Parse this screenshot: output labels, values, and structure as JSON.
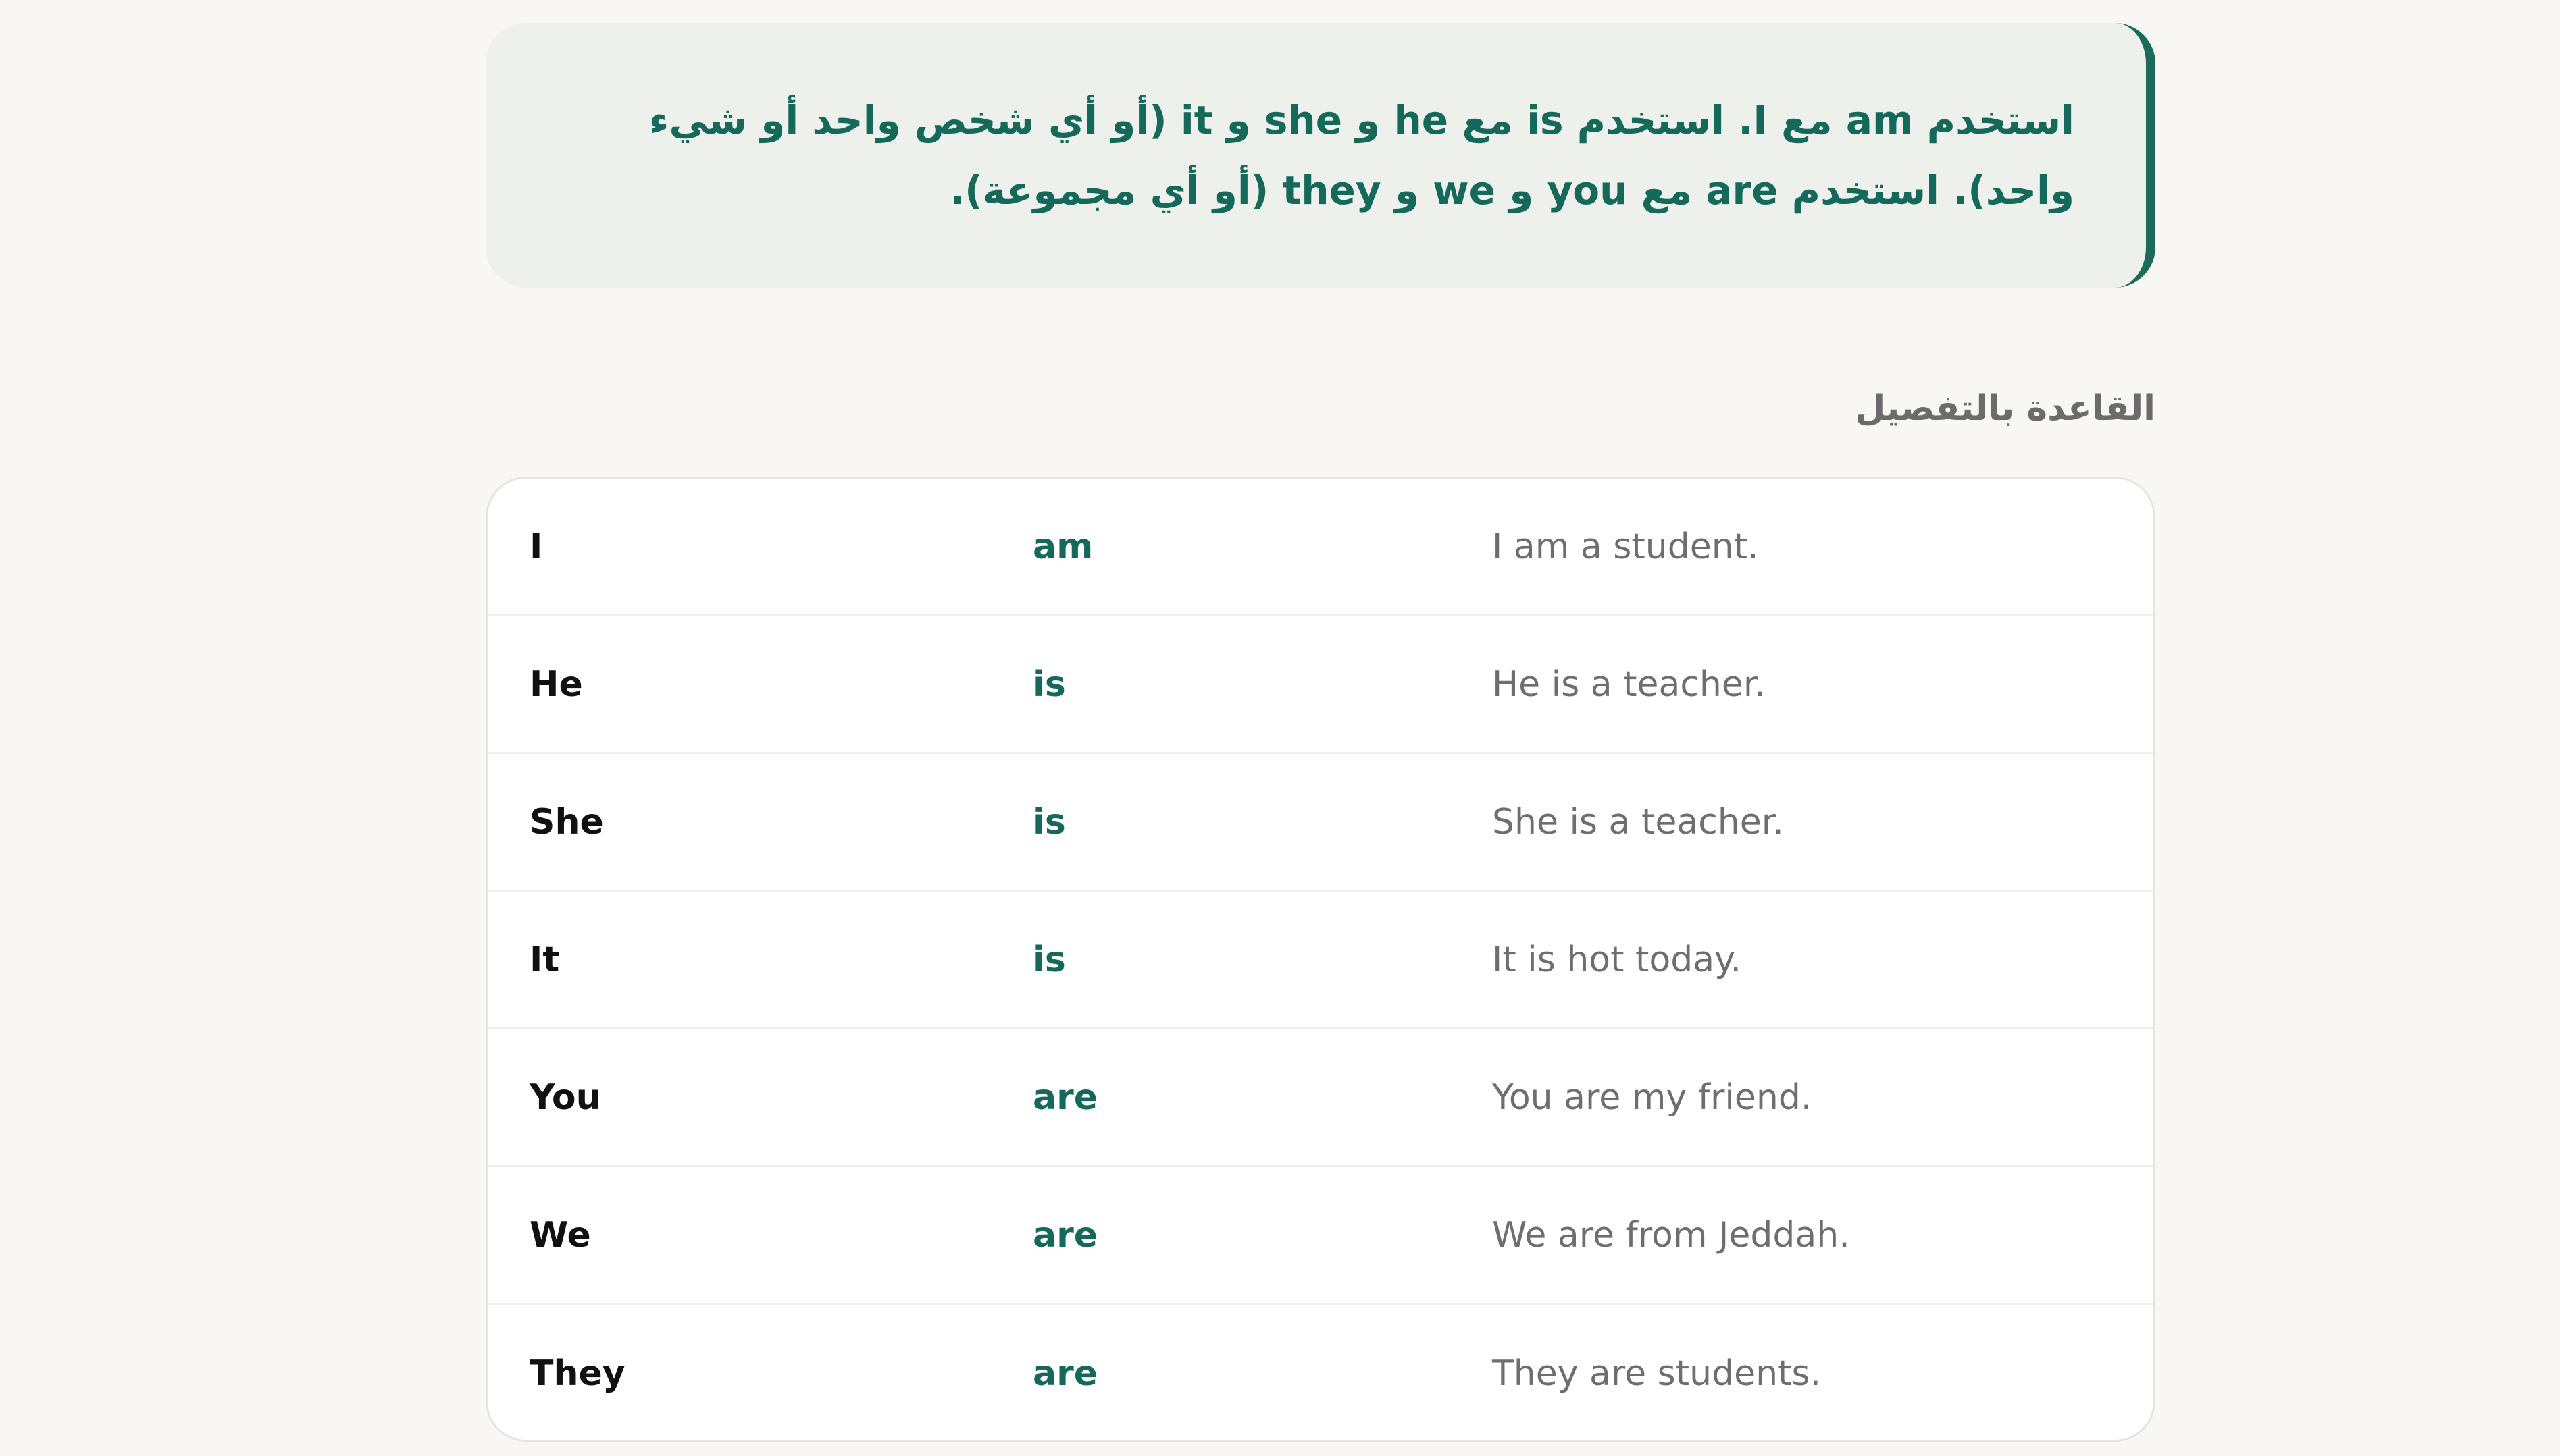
{
  "rule_callout": {
    "text": "استخدم am مع I. استخدم is مع he و she و it (أو أي شخص واحد أو شيء واحد). استخدم are مع you و we و they (أو أي مجموعة)."
  },
  "section": {
    "heading": "القاعدة بالتفصيل"
  },
  "table": {
    "rows": [
      {
        "subject": "I",
        "verb": "am",
        "example": "I am a student."
      },
      {
        "subject": "He",
        "verb": "is",
        "example": "He is a teacher."
      },
      {
        "subject": "She",
        "verb": "is",
        "example": "She is a teacher."
      },
      {
        "subject": "It",
        "verb": "is",
        "example": "It is hot today."
      },
      {
        "subject": "You",
        "verb": "are",
        "example": "You are my friend."
      },
      {
        "subject": "We",
        "verb": "are",
        "example": "We are from Jeddah."
      },
      {
        "subject": "They",
        "verb": "are",
        "example": "They are students."
      }
    ]
  },
  "colors": {
    "accent": "#14695a",
    "background": "#f8f7f3",
    "callout_background": "#eef0ec"
  }
}
